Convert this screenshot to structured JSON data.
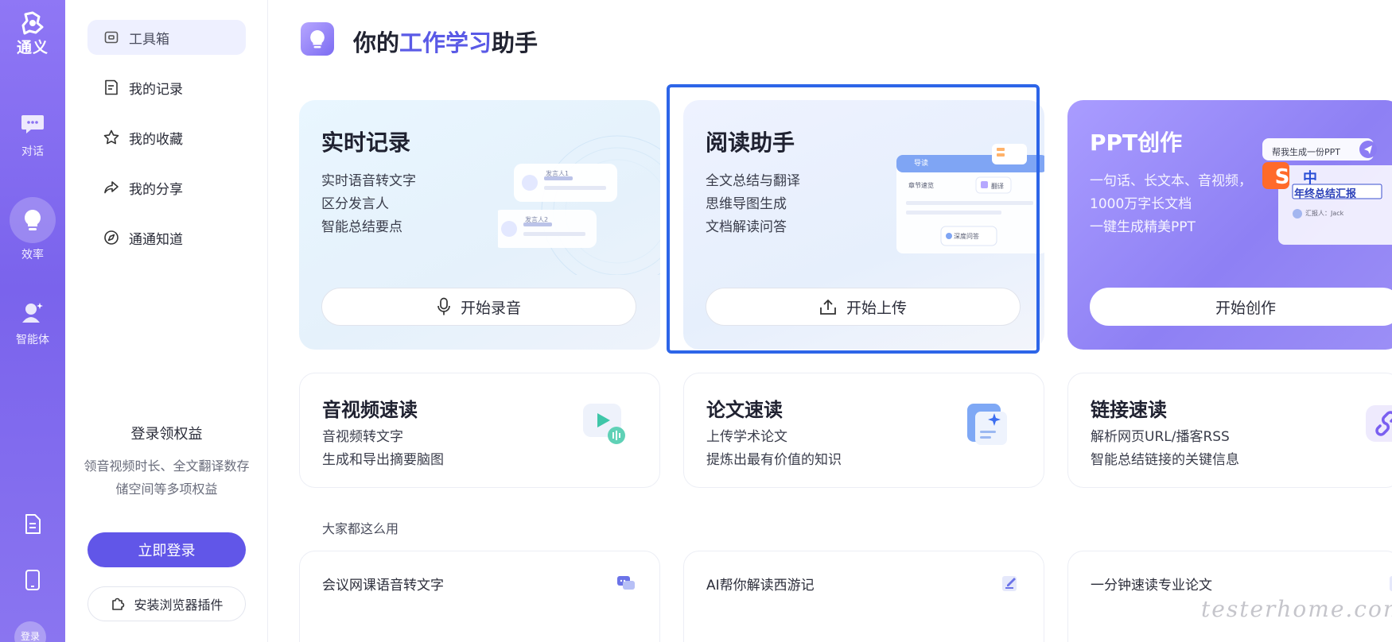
{
  "rail": {
    "logo_text": "通义",
    "items": [
      {
        "label": "对话",
        "icon": "chat-icon"
      },
      {
        "label": "效率",
        "icon": "lightbulb-icon",
        "active": true
      },
      {
        "label": "智能体",
        "icon": "agent-icon"
      }
    ],
    "bottom_icons": [
      "document-icon",
      "tablet-icon"
    ],
    "avatar_label": "登录"
  },
  "sidebar": {
    "items": [
      {
        "label": "工具箱",
        "icon": "toolbox-icon",
        "active": true
      },
      {
        "label": "我的记录",
        "icon": "record-icon"
      },
      {
        "label": "我的收藏",
        "icon": "star-icon"
      },
      {
        "label": "我的分享",
        "icon": "share-icon"
      },
      {
        "label": "通通知道",
        "icon": "compass-icon"
      }
    ],
    "promo_title": "登录领权益",
    "promo_desc": "领音视频时长、全文翻译数存储空间等多项权益",
    "login_button": "立即登录",
    "plugin_button": "安装浏览器插件"
  },
  "header": {
    "title_pre": "你的",
    "title_highlight": "工作学习",
    "title_post": "助手"
  },
  "feature_cards": [
    {
      "title": "实时记录",
      "lines": [
        "实时语音转文字",
        "区分发言人",
        "智能总结要点"
      ],
      "button": "开始录音",
      "button_icon": "microphone-icon",
      "illustration": {
        "speaker1": "发言人1",
        "speaker2": "发言人2"
      }
    },
    {
      "title": "阅读助手",
      "lines": [
        "全文总结与翻译",
        "思维导图生成",
        "文档解读问答"
      ],
      "button": "开始上传",
      "button_icon": "upload-icon",
      "illustration": {
        "guide": "导读",
        "chapter": "章节速览",
        "translate": "翻译",
        "deep_qa": "深度问答"
      }
    },
    {
      "title": "PPT创作",
      "lines": [
        "一句话、长文本、音视频，",
        "1000万字长文档",
        "一键生成精美PPT"
      ],
      "button": "开始创作",
      "button_icon": "",
      "illustration": {
        "prompt": "帮我生成一份PPT",
        "slide_title": "年终总结汇报",
        "reporter": "汇报人：Jack"
      }
    }
  ],
  "quick_cards": [
    {
      "title": "音视频速读",
      "lines": [
        "音视频转文字",
        "生成和导出摘要脑图"
      ],
      "icon": "video-play-icon"
    },
    {
      "title": "论文速读",
      "lines": [
        "上传学术论文",
        "提炼出最有价值的知识"
      ],
      "icon": "paper-sparkle-icon"
    },
    {
      "title": "链接速读",
      "lines": [
        "解析网页URL/播客RSS",
        "智能总结链接的关键信息"
      ],
      "icon": "link-icon"
    }
  ],
  "popular": {
    "label": "大家都这么用",
    "items": [
      {
        "title": "会议网课语音转文字",
        "icon": "chat-bubbles-icon"
      },
      {
        "title": "AI帮你解读西游记",
        "icon": "edit-doc-icon"
      },
      {
        "title": "一分钟速读专业论文",
        "icon": "paper-icon"
      }
    ]
  },
  "ime": {
    "brand": "S",
    "mode": "中"
  },
  "watermark": "testerhome.com",
  "colors": {
    "accent": "#6156e8",
    "focus": "#2d65e8",
    "rail": "#8a72f2"
  }
}
